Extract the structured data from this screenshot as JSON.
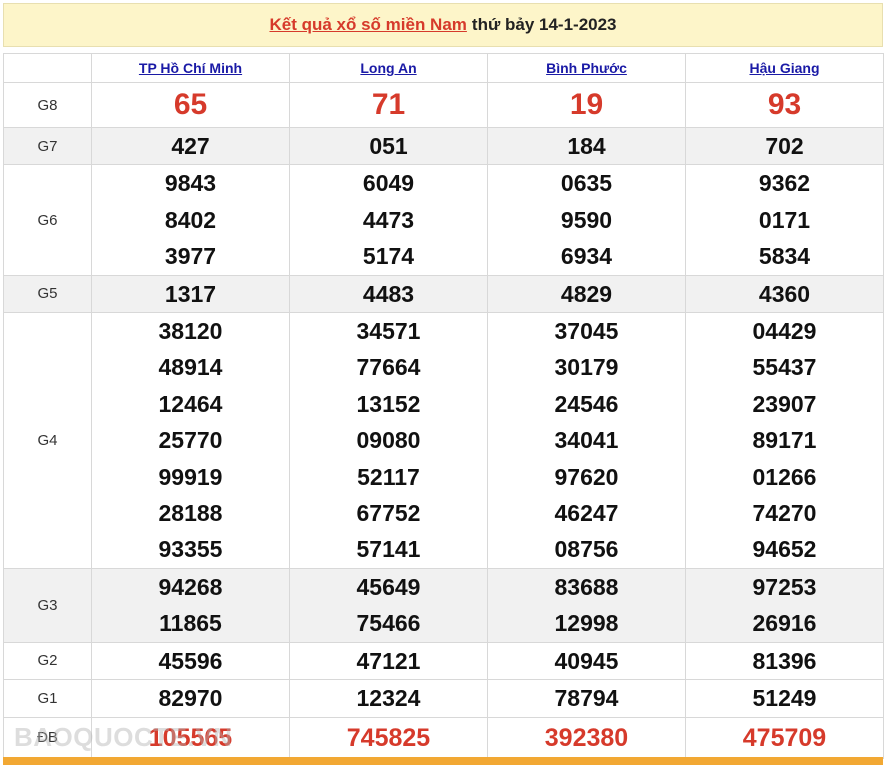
{
  "header": {
    "title": "Kết quả xổ số miền Nam",
    "date_text": "thứ bảy 14-1-2023"
  },
  "provinces": [
    "TP Hồ Chí Minh",
    "Long An",
    "Bình Phước",
    "Hậu Giang"
  ],
  "prizes": [
    {
      "label": "G8",
      "values": [
        [
          "65"
        ],
        [
          "71"
        ],
        [
          "19"
        ],
        [
          "93"
        ]
      ]
    },
    {
      "label": "G7",
      "values": [
        [
          "427"
        ],
        [
          "051"
        ],
        [
          "184"
        ],
        [
          "702"
        ]
      ]
    },
    {
      "label": "G6",
      "values": [
        [
          "9843",
          "8402",
          "3977"
        ],
        [
          "6049",
          "4473",
          "5174"
        ],
        [
          "0635",
          "9590",
          "6934"
        ],
        [
          "9362",
          "0171",
          "5834"
        ]
      ]
    },
    {
      "label": "G5",
      "values": [
        [
          "1317"
        ],
        [
          "4483"
        ],
        [
          "4829"
        ],
        [
          "4360"
        ]
      ]
    },
    {
      "label": "G4",
      "values": [
        [
          "38120",
          "48914",
          "12464",
          "25770",
          "99919",
          "28188",
          "93355"
        ],
        [
          "34571",
          "77664",
          "13152",
          "09080",
          "52117",
          "67752",
          "57141"
        ],
        [
          "37045",
          "30179",
          "24546",
          "34041",
          "97620",
          "46247",
          "08756"
        ],
        [
          "04429",
          "55437",
          "23907",
          "89171",
          "01266",
          "74270",
          "94652"
        ]
      ]
    },
    {
      "label": "G3",
      "values": [
        [
          "94268",
          "11865"
        ],
        [
          "45649",
          "75466"
        ],
        [
          "83688",
          "12998"
        ],
        [
          "97253",
          "26916"
        ]
      ]
    },
    {
      "label": "G2",
      "values": [
        [
          "45596"
        ],
        [
          "47121"
        ],
        [
          "40945"
        ],
        [
          "81396"
        ]
      ]
    },
    {
      "label": "G1",
      "values": [
        [
          "82970"
        ],
        [
          "12324"
        ],
        [
          "78794"
        ],
        [
          "51249"
        ]
      ]
    },
    {
      "label": "ĐB",
      "values": [
        [
          "105565"
        ],
        [
          "745825"
        ],
        [
          "392380"
        ],
        [
          "475709"
        ]
      ]
    }
  ],
  "watermark": "BAOQUOCTE.VN",
  "colors": {
    "accent_red": "#d63a2b",
    "link_blue": "#1a1aa6",
    "header_bg": "#fdf5c9",
    "bottom_bar": "#f2a833"
  }
}
